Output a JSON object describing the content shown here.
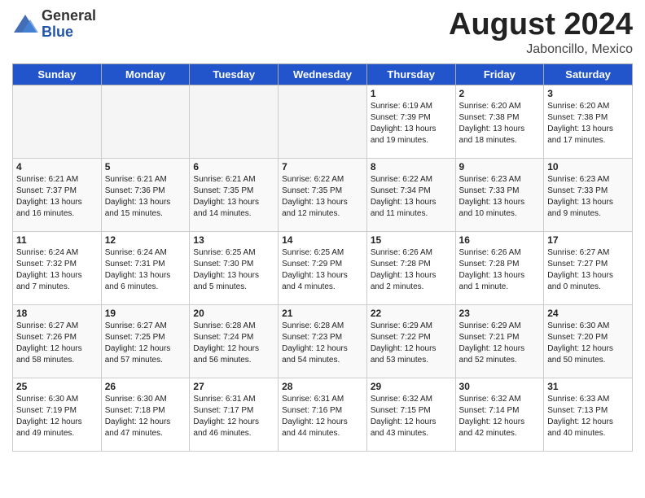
{
  "logo": {
    "general": "General",
    "blue": "Blue"
  },
  "title": "August 2024",
  "location": "Jaboncillo, Mexico",
  "weekdays": [
    "Sunday",
    "Monday",
    "Tuesday",
    "Wednesday",
    "Thursday",
    "Friday",
    "Saturday"
  ],
  "weeks": [
    [
      {
        "day": "",
        "info": ""
      },
      {
        "day": "",
        "info": ""
      },
      {
        "day": "",
        "info": ""
      },
      {
        "day": "",
        "info": ""
      },
      {
        "day": "1",
        "info": "Sunrise: 6:19 AM\nSunset: 7:39 PM\nDaylight: 13 hours\nand 19 minutes."
      },
      {
        "day": "2",
        "info": "Sunrise: 6:20 AM\nSunset: 7:38 PM\nDaylight: 13 hours\nand 18 minutes."
      },
      {
        "day": "3",
        "info": "Sunrise: 6:20 AM\nSunset: 7:38 PM\nDaylight: 13 hours\nand 17 minutes."
      }
    ],
    [
      {
        "day": "4",
        "info": "Sunrise: 6:21 AM\nSunset: 7:37 PM\nDaylight: 13 hours\nand 16 minutes."
      },
      {
        "day": "5",
        "info": "Sunrise: 6:21 AM\nSunset: 7:36 PM\nDaylight: 13 hours\nand 15 minutes."
      },
      {
        "day": "6",
        "info": "Sunrise: 6:21 AM\nSunset: 7:35 PM\nDaylight: 13 hours\nand 14 minutes."
      },
      {
        "day": "7",
        "info": "Sunrise: 6:22 AM\nSunset: 7:35 PM\nDaylight: 13 hours\nand 12 minutes."
      },
      {
        "day": "8",
        "info": "Sunrise: 6:22 AM\nSunset: 7:34 PM\nDaylight: 13 hours\nand 11 minutes."
      },
      {
        "day": "9",
        "info": "Sunrise: 6:23 AM\nSunset: 7:33 PM\nDaylight: 13 hours\nand 10 minutes."
      },
      {
        "day": "10",
        "info": "Sunrise: 6:23 AM\nSunset: 7:33 PM\nDaylight: 13 hours\nand 9 minutes."
      }
    ],
    [
      {
        "day": "11",
        "info": "Sunrise: 6:24 AM\nSunset: 7:32 PM\nDaylight: 13 hours\nand 7 minutes."
      },
      {
        "day": "12",
        "info": "Sunrise: 6:24 AM\nSunset: 7:31 PM\nDaylight: 13 hours\nand 6 minutes."
      },
      {
        "day": "13",
        "info": "Sunrise: 6:25 AM\nSunset: 7:30 PM\nDaylight: 13 hours\nand 5 minutes."
      },
      {
        "day": "14",
        "info": "Sunrise: 6:25 AM\nSunset: 7:29 PM\nDaylight: 13 hours\nand 4 minutes."
      },
      {
        "day": "15",
        "info": "Sunrise: 6:26 AM\nSunset: 7:28 PM\nDaylight: 13 hours\nand 2 minutes."
      },
      {
        "day": "16",
        "info": "Sunrise: 6:26 AM\nSunset: 7:28 PM\nDaylight: 13 hours\nand 1 minute."
      },
      {
        "day": "17",
        "info": "Sunrise: 6:27 AM\nSunset: 7:27 PM\nDaylight: 13 hours\nand 0 minutes."
      }
    ],
    [
      {
        "day": "18",
        "info": "Sunrise: 6:27 AM\nSunset: 7:26 PM\nDaylight: 12 hours\nand 58 minutes."
      },
      {
        "day": "19",
        "info": "Sunrise: 6:27 AM\nSunset: 7:25 PM\nDaylight: 12 hours\nand 57 minutes."
      },
      {
        "day": "20",
        "info": "Sunrise: 6:28 AM\nSunset: 7:24 PM\nDaylight: 12 hours\nand 56 minutes."
      },
      {
        "day": "21",
        "info": "Sunrise: 6:28 AM\nSunset: 7:23 PM\nDaylight: 12 hours\nand 54 minutes."
      },
      {
        "day": "22",
        "info": "Sunrise: 6:29 AM\nSunset: 7:22 PM\nDaylight: 12 hours\nand 53 minutes."
      },
      {
        "day": "23",
        "info": "Sunrise: 6:29 AM\nSunset: 7:21 PM\nDaylight: 12 hours\nand 52 minutes."
      },
      {
        "day": "24",
        "info": "Sunrise: 6:30 AM\nSunset: 7:20 PM\nDaylight: 12 hours\nand 50 minutes."
      }
    ],
    [
      {
        "day": "25",
        "info": "Sunrise: 6:30 AM\nSunset: 7:19 PM\nDaylight: 12 hours\nand 49 minutes."
      },
      {
        "day": "26",
        "info": "Sunrise: 6:30 AM\nSunset: 7:18 PM\nDaylight: 12 hours\nand 47 minutes."
      },
      {
        "day": "27",
        "info": "Sunrise: 6:31 AM\nSunset: 7:17 PM\nDaylight: 12 hours\nand 46 minutes."
      },
      {
        "day": "28",
        "info": "Sunrise: 6:31 AM\nSunset: 7:16 PM\nDaylight: 12 hours\nand 44 minutes."
      },
      {
        "day": "29",
        "info": "Sunrise: 6:32 AM\nSunset: 7:15 PM\nDaylight: 12 hours\nand 43 minutes."
      },
      {
        "day": "30",
        "info": "Sunrise: 6:32 AM\nSunset: 7:14 PM\nDaylight: 12 hours\nand 42 minutes."
      },
      {
        "day": "31",
        "info": "Sunrise: 6:33 AM\nSunset: 7:13 PM\nDaylight: 12 hours\nand 40 minutes."
      }
    ]
  ]
}
